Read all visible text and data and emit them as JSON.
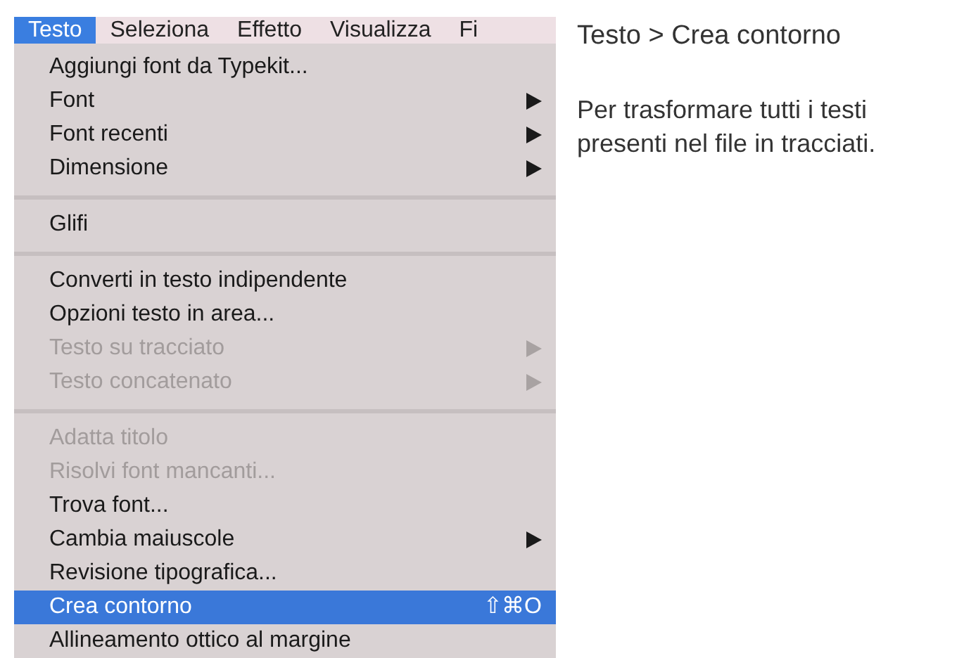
{
  "menu_bar": [
    {
      "label": "Testo",
      "selected": true
    },
    {
      "label": "Seleziona",
      "selected": false
    },
    {
      "label": "Effetto",
      "selected": false
    },
    {
      "label": "Visualizza",
      "selected": false
    },
    {
      "label": "Fi",
      "selected": false
    }
  ],
  "menu": [
    {
      "kind": "item",
      "label": "Aggiungi font da Typekit...",
      "disabled": false,
      "submenu": false,
      "selected": false
    },
    {
      "kind": "item",
      "label": "Font",
      "disabled": false,
      "submenu": true,
      "selected": false
    },
    {
      "kind": "item",
      "label": "Font recenti",
      "disabled": false,
      "submenu": true,
      "selected": false
    },
    {
      "kind": "item",
      "label": "Dimensione",
      "disabled": false,
      "submenu": true,
      "selected": false
    },
    {
      "kind": "separator"
    },
    {
      "kind": "item",
      "label": "Glifi",
      "disabled": false,
      "submenu": false,
      "selected": false
    },
    {
      "kind": "separator"
    },
    {
      "kind": "item",
      "label": "Converti in testo indipendente",
      "disabled": false,
      "submenu": false,
      "selected": false
    },
    {
      "kind": "item",
      "label": "Opzioni testo in area...",
      "disabled": false,
      "submenu": false,
      "selected": false
    },
    {
      "kind": "item",
      "label": "Testo su tracciato",
      "disabled": true,
      "submenu": true,
      "selected": false
    },
    {
      "kind": "item",
      "label": "Testo concatenato",
      "disabled": true,
      "submenu": true,
      "selected": false
    },
    {
      "kind": "separator"
    },
    {
      "kind": "item",
      "label": "Adatta titolo",
      "disabled": true,
      "submenu": false,
      "selected": false
    },
    {
      "kind": "item",
      "label": "Risolvi font mancanti...",
      "disabled": true,
      "submenu": false,
      "selected": false
    },
    {
      "kind": "item",
      "label": "Trova font...",
      "disabled": false,
      "submenu": false,
      "selected": false
    },
    {
      "kind": "item",
      "label": "Cambia maiuscole",
      "disabled": false,
      "submenu": true,
      "selected": false
    },
    {
      "kind": "item",
      "label": "Revisione tipografica...",
      "disabled": false,
      "submenu": false,
      "selected": false
    },
    {
      "kind": "item",
      "label": "Crea contorno",
      "disabled": false,
      "submenu": false,
      "selected": true,
      "shortcut": "⇧⌘O"
    },
    {
      "kind": "item",
      "label": "Allineamento ottico al margine",
      "disabled": false,
      "submenu": false,
      "selected": false
    }
  ],
  "caption": {
    "title": "Testo > Crea contorno",
    "body": "Per trasformare tutti i testi\npresenti nel file in tracciati."
  }
}
